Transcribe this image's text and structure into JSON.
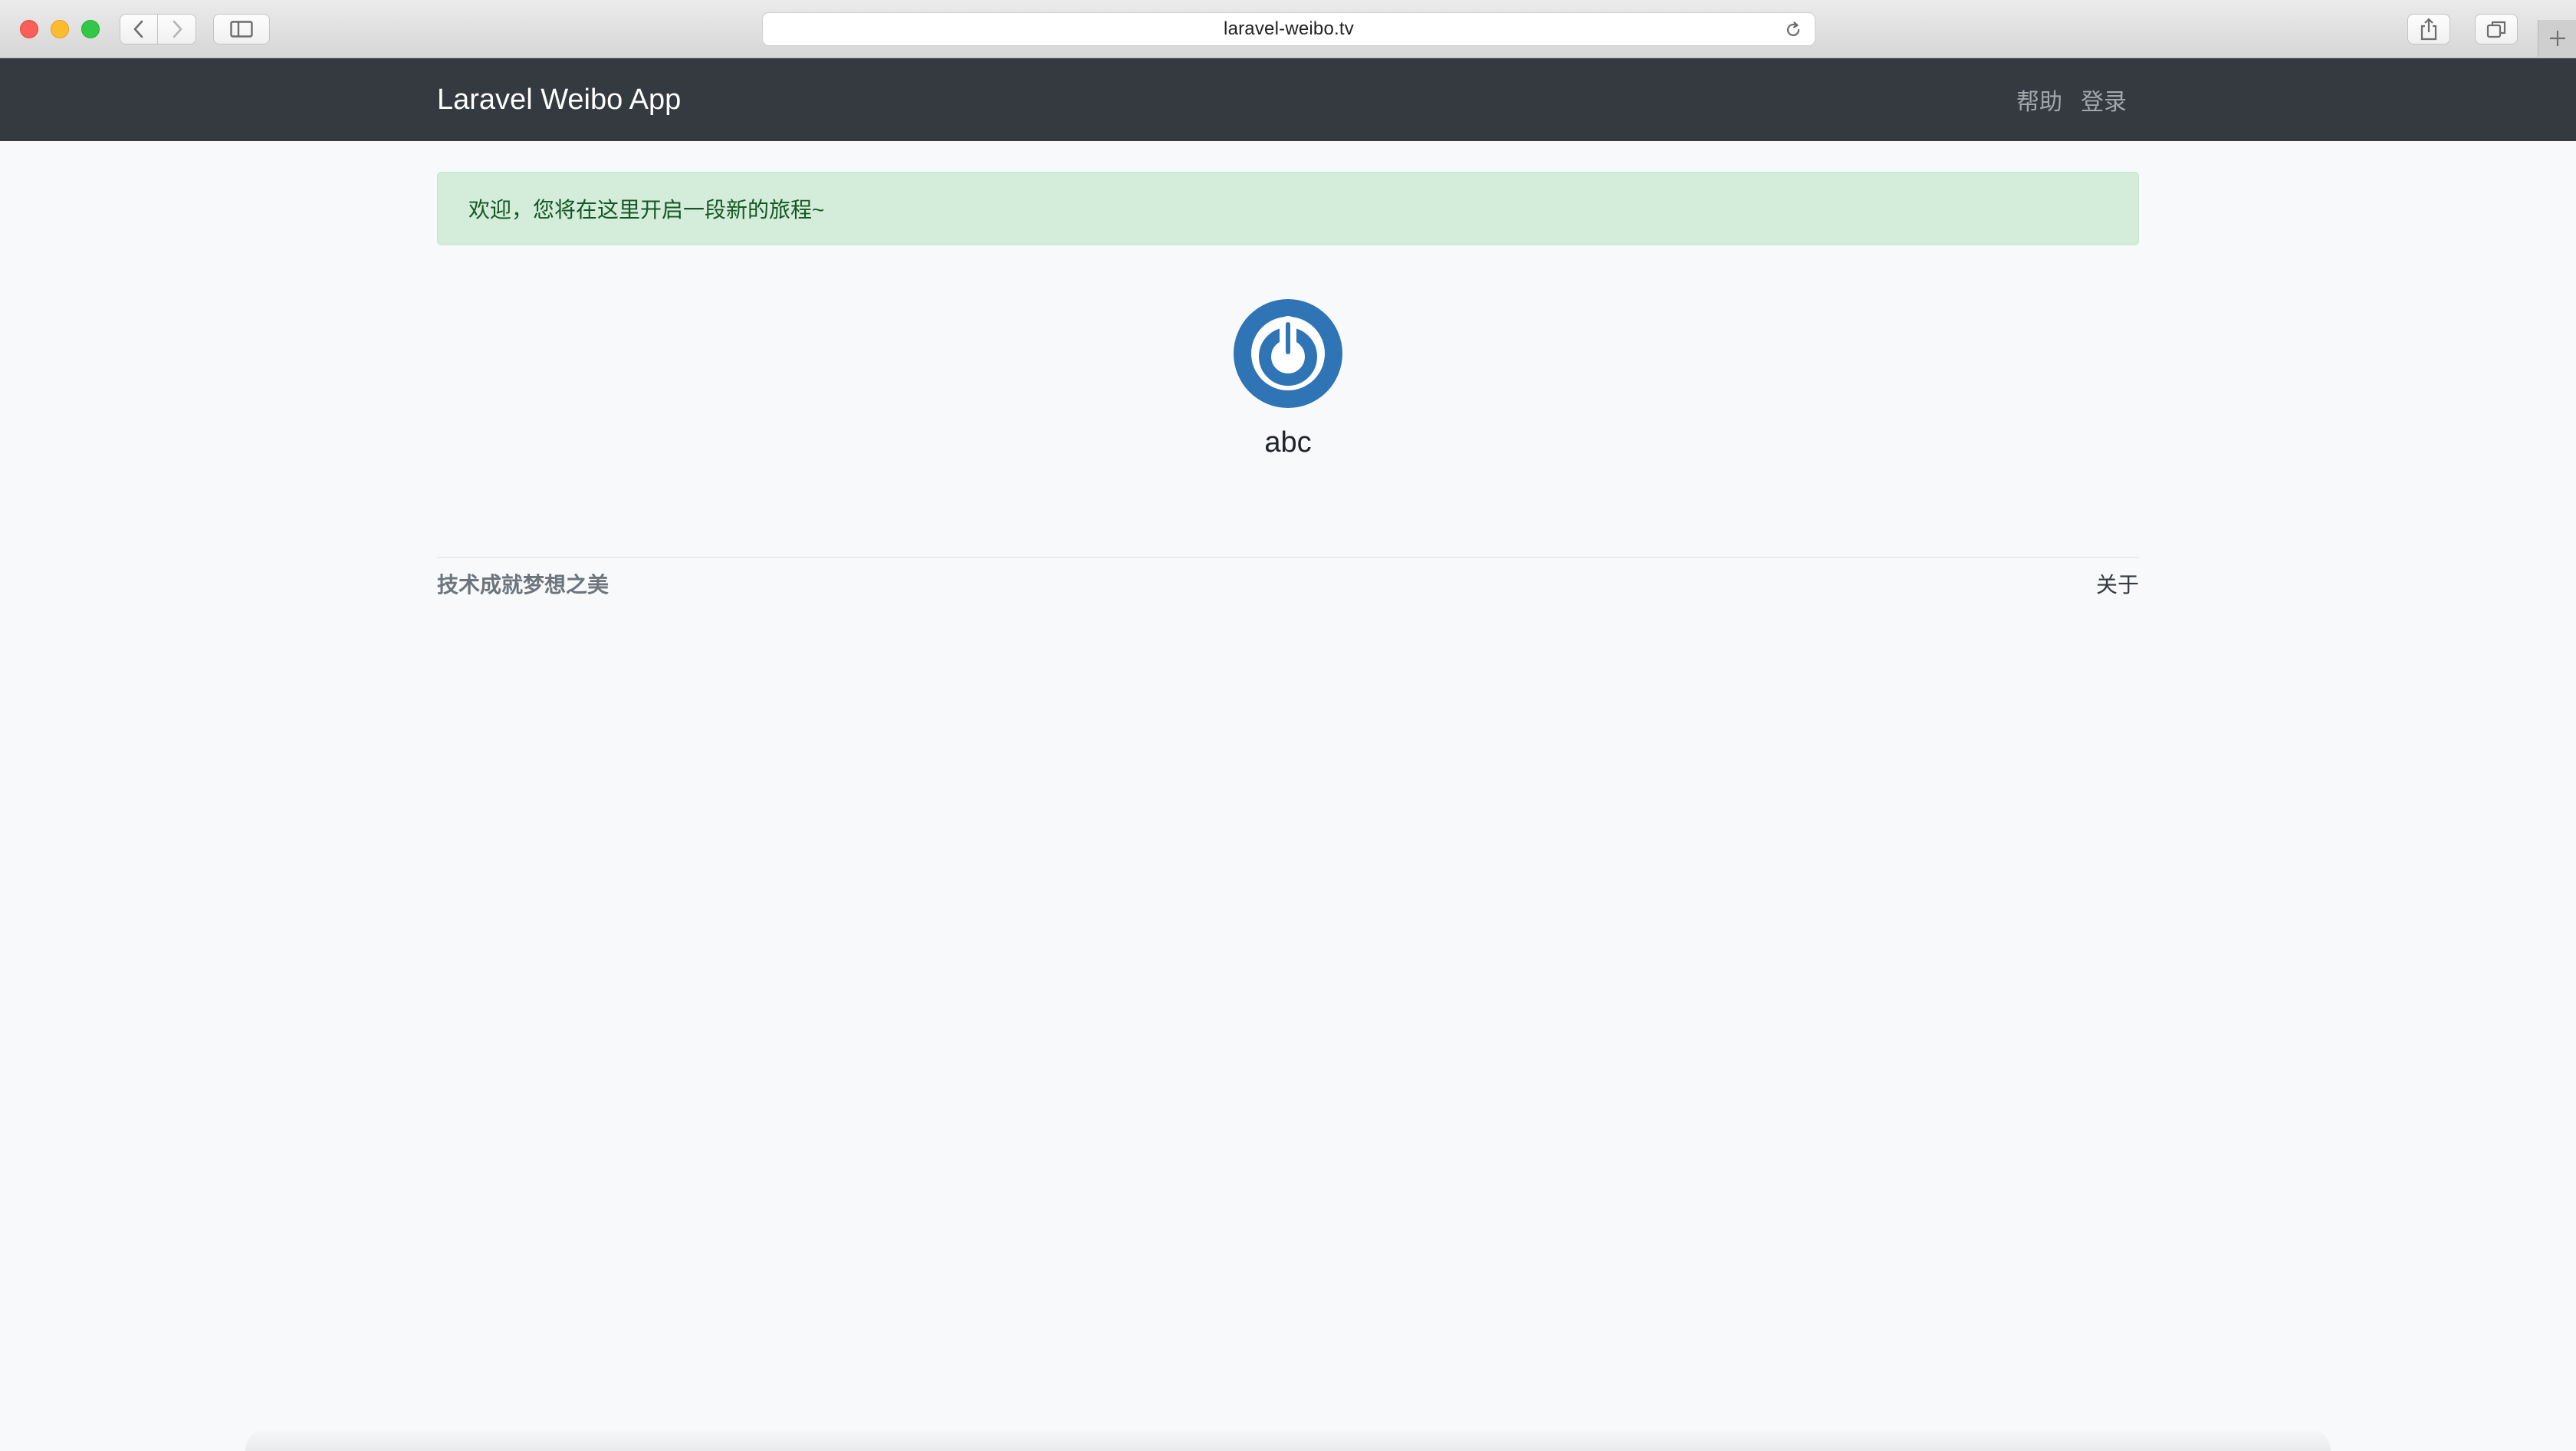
{
  "browser": {
    "url": "laravel-weibo.tv"
  },
  "navbar": {
    "brand": "Laravel Weibo App",
    "links": [
      {
        "label": "帮助"
      },
      {
        "label": "登录"
      }
    ]
  },
  "alert": {
    "message": "欢迎，您将在这里开启一段新的旅程~",
    "color": "#155724",
    "background": "#d4edda"
  },
  "profile": {
    "avatar_icon": "power-icon",
    "avatar_color": "#2f74b5",
    "username": "abc"
  },
  "footer": {
    "slogan": "技术成就梦想之美",
    "about": "关于"
  }
}
